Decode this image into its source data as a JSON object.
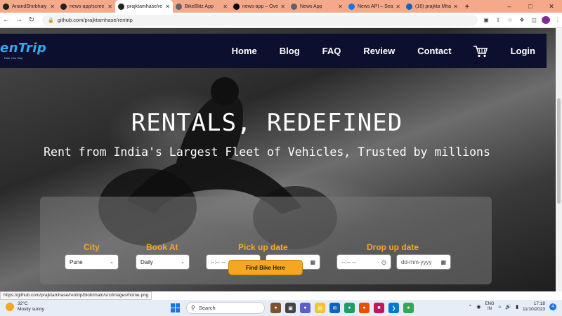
{
  "browser": {
    "tabs": [
      {
        "label": "AnandShirbhaiy",
        "icon": "github-icon",
        "color": "#222222"
      },
      {
        "label": "news-app/scree",
        "icon": "github-icon",
        "color": "#222222"
      },
      {
        "label": "prajktamhase/re",
        "icon": "github-icon",
        "color": "#222222",
        "active": true
      },
      {
        "label": "BikeBlitz App",
        "icon": "globe-icon",
        "color": "#5f6368"
      },
      {
        "label": "news-app – Ove",
        "icon": "vercel-icon",
        "color": "#000000"
      },
      {
        "label": "News App",
        "icon": "globe-icon",
        "color": "#5f6368"
      },
      {
        "label": "News API – Sear",
        "icon": "news-icon",
        "color": "#1a73e8"
      },
      {
        "label": "(16) prajkta Mha",
        "icon": "linkedin-icon",
        "color": "#0a66c2"
      }
    ],
    "url": "github.com/prajktamhase/rentrip",
    "status_url": "https://github.com/prajktamhase/rentrip/blob/main/src/images/home.png",
    "profile_initial": "P"
  },
  "site": {
    "logo": "enTrip",
    "logo_tagline": "Ride Your Way",
    "nav": [
      "Home",
      "Blog",
      "FAQ",
      "Review",
      "Contact",
      "Login"
    ],
    "hero_title": "RENTALS, REDEFINED",
    "hero_subtitle": "Rent from India's Largest Fleet of Vehicles, Trusted by millions",
    "form": {
      "city_label": "City",
      "city_value": "Pune",
      "book_label": "Book At",
      "book_value": "Daily",
      "pickup_label": "Pick up date",
      "dropoff_label": "Drop up date",
      "time_placeholder": "--:-- --",
      "date_placeholder": "dd-mm-yyyy",
      "find_button": "Find Bike Here"
    },
    "accent_color": "#f3a823",
    "nav_color": "#0d0f2e"
  },
  "taskbar": {
    "temperature": "32°C",
    "weather": "Mostly sunny",
    "search": "Search",
    "lang": "ENG",
    "region": "IN",
    "time": "17:18",
    "date": "11/10/2023",
    "notification_count": "4"
  }
}
